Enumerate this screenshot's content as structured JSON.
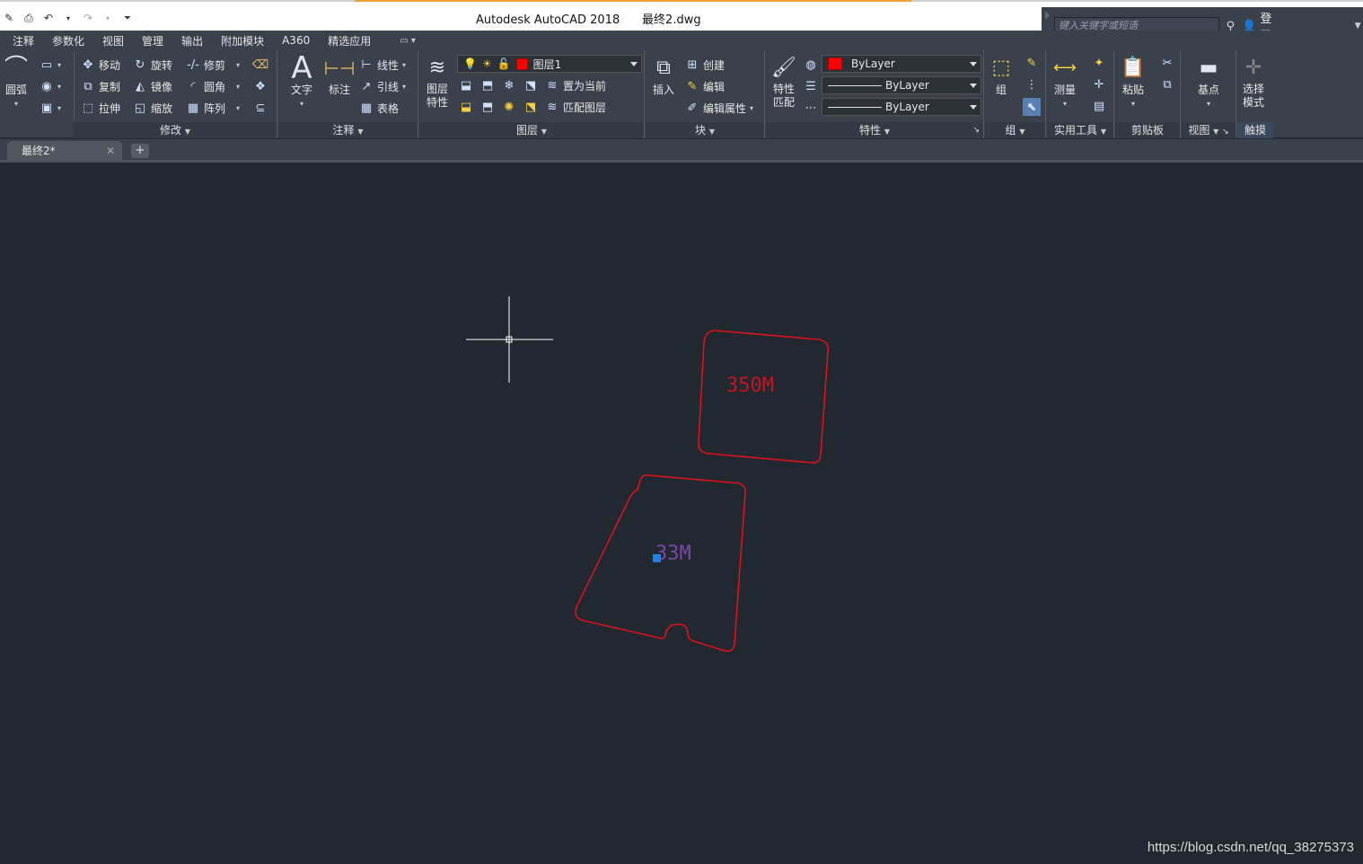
{
  "window": {
    "app_name": "Autodesk AutoCAD 2018",
    "document_name": "最终2.dwg"
  },
  "search": {
    "placeholder": "键入关键字或短语",
    "login_label": "登录"
  },
  "menu_tabs": [
    "注释",
    "参数化",
    "视图",
    "管理",
    "输出",
    "附加模块",
    "A360",
    "精选应用"
  ],
  "ribbon": {
    "modify": {
      "arc_label": "圆弧",
      "move": "移动",
      "rotate": "旋转",
      "trim": "修剪",
      "copy": "复制",
      "mirror": "镜像",
      "fillet": "圆角",
      "stretch": "拉伸",
      "scale": "缩放",
      "array": "阵列",
      "title": "修改"
    },
    "annotation": {
      "text": "文字",
      "dimension": "标注",
      "linear": "线性",
      "leader": "引线",
      "table": "表格",
      "title": "注释"
    },
    "layers": {
      "layer_properties": "图层\n特性",
      "current_layer": "图层1",
      "set_current": "置为当前",
      "match_layer": "匹配图层",
      "title": "图层"
    },
    "block": {
      "insert": "插入",
      "create": "创建",
      "edit": "编辑",
      "edit_attributes": "编辑属性",
      "title": "块"
    },
    "properties": {
      "match_properties": "特性\n匹配",
      "color": "ByLayer",
      "linetype": "ByLayer",
      "lineweight": "ByLayer",
      "title": "特性"
    },
    "groups": {
      "group": "组",
      "title": "组"
    },
    "utilities": {
      "measure": "测量",
      "title": "实用工具"
    },
    "clipboard": {
      "paste": "粘贴",
      "title": "剪贴板"
    },
    "view": {
      "base": "基点",
      "title": "视图"
    },
    "touch": {
      "select_mode": "选择\n模式",
      "title": "触摸"
    }
  },
  "doc_tab": {
    "label": "最终2*"
  },
  "drawing": {
    "upper_shape_label": "350M",
    "lower_shape_label": "33M",
    "shape_color": "#e0101c",
    "label_color_upper": "#c81420",
    "label_color_lower": "#7a4aa8",
    "grip_color": "#1e7fe8"
  },
  "watermark": "https://blog.csdn.net/qq_38275373"
}
